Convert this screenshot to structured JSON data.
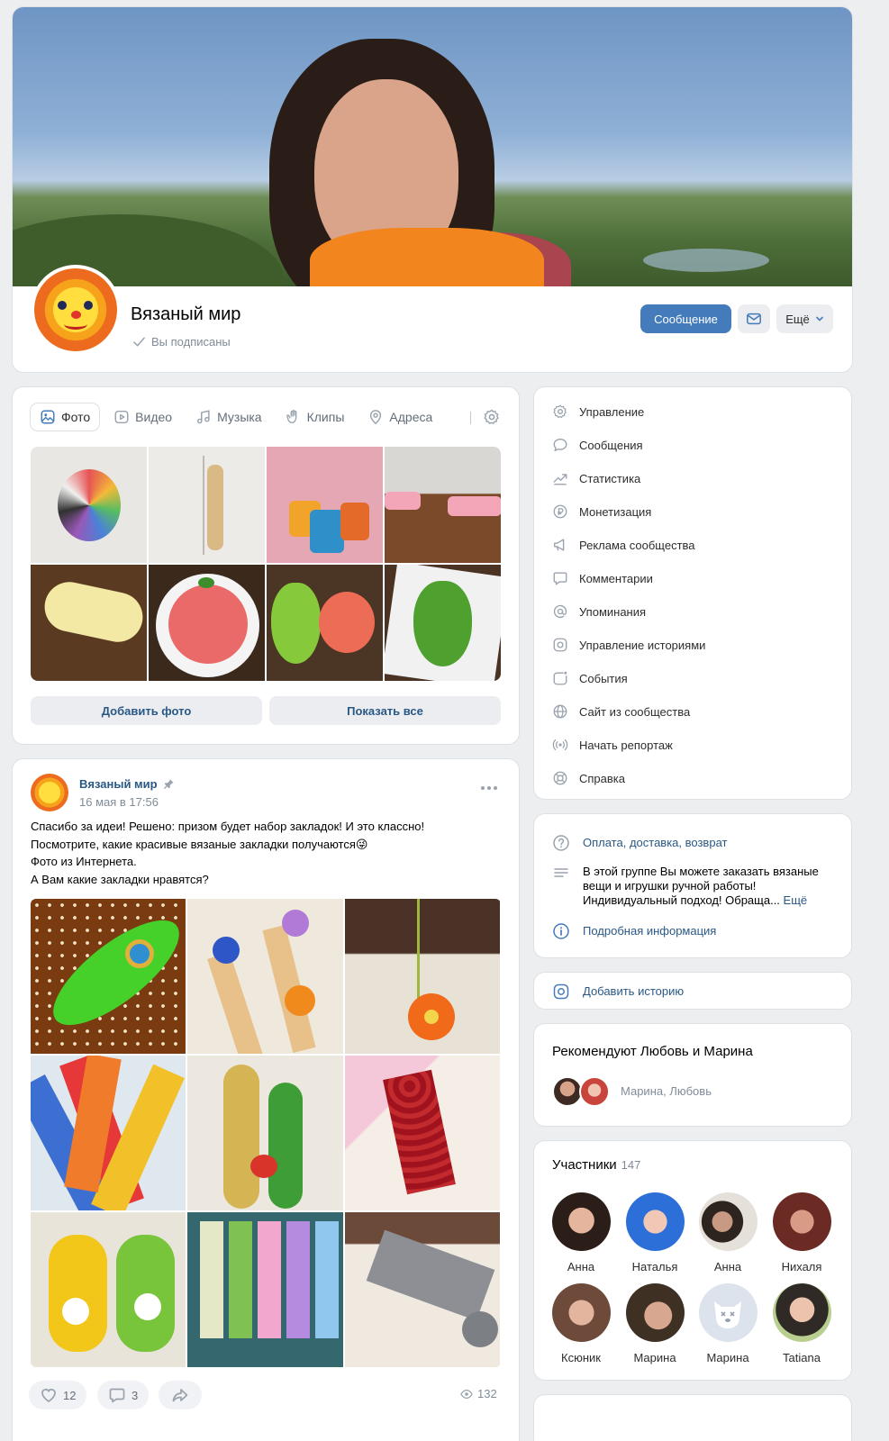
{
  "header": {
    "group_name": "Вязаный мир",
    "subscribed_label": "Вы подписаны",
    "message_button": "Сообщение",
    "more_button": "Ещё",
    "accent_color": "#447bba"
  },
  "media": {
    "tabs": [
      {
        "label": "Фото",
        "icon": "photo-icon",
        "active": true
      },
      {
        "label": "Видео",
        "icon": "video-icon"
      },
      {
        "label": "Музыка",
        "icon": "music-icon"
      },
      {
        "label": "Клипы",
        "icon": "clips-icon"
      },
      {
        "label": "Адреса",
        "icon": "location-icon"
      }
    ],
    "add_photo_button": "Добавить фото",
    "show_all_button": "Показать все"
  },
  "post": {
    "author": "Вязаный мир",
    "date": "16 мая в 17:56",
    "text_lines": [
      "Спасибо за идеи! Решено: призом будет набор закладок! И это классно!",
      "Посмотрите, какие красивые вязаные закладки получаются😜",
      "Фото из Интернета.",
      "А Вам какие закладки нравятся?"
    ],
    "likes": "12",
    "comments": "3",
    "views": "132"
  },
  "menu": {
    "items": [
      {
        "label": "Управление",
        "icon": "gear-icon"
      },
      {
        "label": "Сообщения",
        "icon": "chat-icon"
      },
      {
        "label": "Статистика",
        "icon": "stats-icon"
      },
      {
        "label": "Монетизация",
        "icon": "ruble-icon"
      },
      {
        "label": "Реклама сообщества",
        "icon": "megaphone-icon"
      },
      {
        "label": "Комментарии",
        "icon": "comment-icon"
      },
      {
        "label": "Упоминания",
        "icon": "at-icon"
      },
      {
        "label": "Управление историями",
        "icon": "story-icon"
      },
      {
        "label": "События",
        "icon": "event-icon"
      },
      {
        "label": "Сайт из сообщества",
        "icon": "globe-icon"
      },
      {
        "label": "Начать репортаж",
        "icon": "broadcast-icon"
      },
      {
        "label": "Справка",
        "icon": "help-icon"
      }
    ]
  },
  "info": {
    "payment_link": "Оплата, доставка, возврат",
    "description": "В этой группе Вы можете заказать вязаные вещи и игрушки ручной работы! Индивидуальный подход! Обраща...",
    "description_more": "Ещё",
    "details_link": "Подробная информация"
  },
  "story": {
    "add_story": "Добавить историю"
  },
  "recommend": {
    "title": "Рекомендуют Любовь и Марина",
    "names": "Марина, Любовь"
  },
  "members": {
    "title": "Участники",
    "count": "147",
    "list": [
      "Анна",
      "Наталья",
      "Анна",
      "Нихаля",
      "Ксюник",
      "Марина",
      "Марина",
      "Tatiana"
    ]
  }
}
